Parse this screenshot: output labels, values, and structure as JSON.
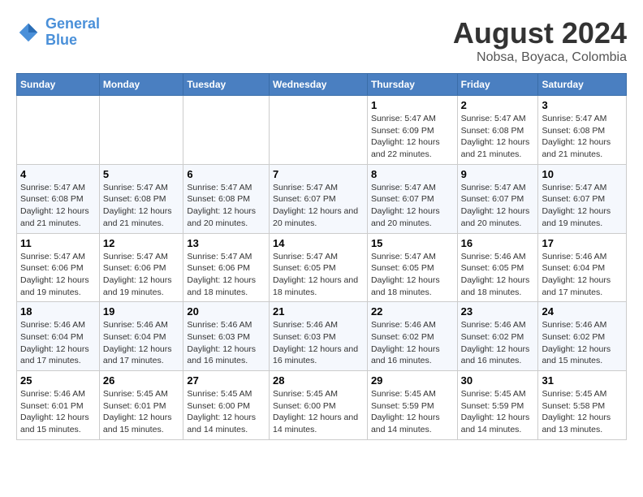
{
  "logo": {
    "text_general": "General",
    "text_blue": "Blue"
  },
  "title": "August 2024",
  "subtitle": "Nobsa, Boyaca, Colombia",
  "weekdays": [
    "Sunday",
    "Monday",
    "Tuesday",
    "Wednesday",
    "Thursday",
    "Friday",
    "Saturday"
  ],
  "weeks": [
    [
      {
        "day": "",
        "info": ""
      },
      {
        "day": "",
        "info": ""
      },
      {
        "day": "",
        "info": ""
      },
      {
        "day": "",
        "info": ""
      },
      {
        "day": "1",
        "info": "Sunrise: 5:47 AM\nSunset: 6:09 PM\nDaylight: 12 hours\nand 22 minutes."
      },
      {
        "day": "2",
        "info": "Sunrise: 5:47 AM\nSunset: 6:08 PM\nDaylight: 12 hours\nand 21 minutes."
      },
      {
        "day": "3",
        "info": "Sunrise: 5:47 AM\nSunset: 6:08 PM\nDaylight: 12 hours\nand 21 minutes."
      }
    ],
    [
      {
        "day": "4",
        "info": "Sunrise: 5:47 AM\nSunset: 6:08 PM\nDaylight: 12 hours\nand 21 minutes."
      },
      {
        "day": "5",
        "info": "Sunrise: 5:47 AM\nSunset: 6:08 PM\nDaylight: 12 hours\nand 21 minutes."
      },
      {
        "day": "6",
        "info": "Sunrise: 5:47 AM\nSunset: 6:08 PM\nDaylight: 12 hours\nand 20 minutes."
      },
      {
        "day": "7",
        "info": "Sunrise: 5:47 AM\nSunset: 6:07 PM\nDaylight: 12 hours\nand 20 minutes."
      },
      {
        "day": "8",
        "info": "Sunrise: 5:47 AM\nSunset: 6:07 PM\nDaylight: 12 hours\nand 20 minutes."
      },
      {
        "day": "9",
        "info": "Sunrise: 5:47 AM\nSunset: 6:07 PM\nDaylight: 12 hours\nand 20 minutes."
      },
      {
        "day": "10",
        "info": "Sunrise: 5:47 AM\nSunset: 6:07 PM\nDaylight: 12 hours\nand 19 minutes."
      }
    ],
    [
      {
        "day": "11",
        "info": "Sunrise: 5:47 AM\nSunset: 6:06 PM\nDaylight: 12 hours\nand 19 minutes."
      },
      {
        "day": "12",
        "info": "Sunrise: 5:47 AM\nSunset: 6:06 PM\nDaylight: 12 hours\nand 19 minutes."
      },
      {
        "day": "13",
        "info": "Sunrise: 5:47 AM\nSunset: 6:06 PM\nDaylight: 12 hours\nand 18 minutes."
      },
      {
        "day": "14",
        "info": "Sunrise: 5:47 AM\nSunset: 6:05 PM\nDaylight: 12 hours\nand 18 minutes."
      },
      {
        "day": "15",
        "info": "Sunrise: 5:47 AM\nSunset: 6:05 PM\nDaylight: 12 hours\nand 18 minutes."
      },
      {
        "day": "16",
        "info": "Sunrise: 5:46 AM\nSunset: 6:05 PM\nDaylight: 12 hours\nand 18 minutes."
      },
      {
        "day": "17",
        "info": "Sunrise: 5:46 AM\nSunset: 6:04 PM\nDaylight: 12 hours\nand 17 minutes."
      }
    ],
    [
      {
        "day": "18",
        "info": "Sunrise: 5:46 AM\nSunset: 6:04 PM\nDaylight: 12 hours\nand 17 minutes."
      },
      {
        "day": "19",
        "info": "Sunrise: 5:46 AM\nSunset: 6:04 PM\nDaylight: 12 hours\nand 17 minutes."
      },
      {
        "day": "20",
        "info": "Sunrise: 5:46 AM\nSunset: 6:03 PM\nDaylight: 12 hours\nand 16 minutes."
      },
      {
        "day": "21",
        "info": "Sunrise: 5:46 AM\nSunset: 6:03 PM\nDaylight: 12 hours\nand 16 minutes."
      },
      {
        "day": "22",
        "info": "Sunrise: 5:46 AM\nSunset: 6:02 PM\nDaylight: 12 hours\nand 16 minutes."
      },
      {
        "day": "23",
        "info": "Sunrise: 5:46 AM\nSunset: 6:02 PM\nDaylight: 12 hours\nand 16 minutes."
      },
      {
        "day": "24",
        "info": "Sunrise: 5:46 AM\nSunset: 6:02 PM\nDaylight: 12 hours\nand 15 minutes."
      }
    ],
    [
      {
        "day": "25",
        "info": "Sunrise: 5:46 AM\nSunset: 6:01 PM\nDaylight: 12 hours\nand 15 minutes."
      },
      {
        "day": "26",
        "info": "Sunrise: 5:45 AM\nSunset: 6:01 PM\nDaylight: 12 hours\nand 15 minutes."
      },
      {
        "day": "27",
        "info": "Sunrise: 5:45 AM\nSunset: 6:00 PM\nDaylight: 12 hours\nand 14 minutes."
      },
      {
        "day": "28",
        "info": "Sunrise: 5:45 AM\nSunset: 6:00 PM\nDaylight: 12 hours\nand 14 minutes."
      },
      {
        "day": "29",
        "info": "Sunrise: 5:45 AM\nSunset: 5:59 PM\nDaylight: 12 hours\nand 14 minutes."
      },
      {
        "day": "30",
        "info": "Sunrise: 5:45 AM\nSunset: 5:59 PM\nDaylight: 12 hours\nand 14 minutes."
      },
      {
        "day": "31",
        "info": "Sunrise: 5:45 AM\nSunset: 5:58 PM\nDaylight: 12 hours\nand 13 minutes."
      }
    ]
  ]
}
